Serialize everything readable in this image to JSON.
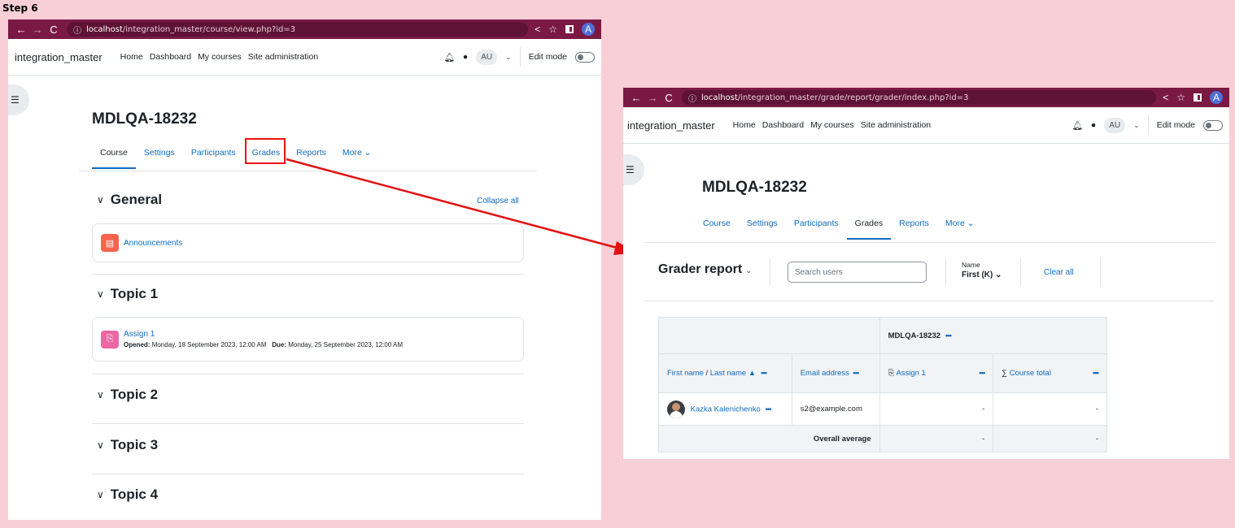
{
  "step_label": "Step 6",
  "left": {
    "url_host": "localhost",
    "url_path": "/integration_master/course/view.php?id=3",
    "brand": "integration_master",
    "nav": [
      "Home",
      "Dashboard",
      "My courses",
      "Site administration"
    ],
    "user_initials": "AU",
    "profile_letter": "A",
    "edit_mode": "Edit mode",
    "course_title": "MDLQA-18232",
    "tabs": [
      "Course",
      "Settings",
      "Participants",
      "Grades",
      "Reports",
      "More"
    ],
    "collapse_all": "Collapse all",
    "sections": {
      "general": "General",
      "topic1": "Topic 1",
      "topic2": "Topic 2",
      "topic3": "Topic 3",
      "topic4": "Topic 4"
    },
    "announcements": "Announcements",
    "assign": {
      "name": "Assign 1",
      "opened_label": "Opened:",
      "opened_value": "Monday, 18 September 2023, 12:00 AM",
      "due_label": "Due:",
      "due_value": "Monday, 25 September 2023, 12:00 AM"
    }
  },
  "right": {
    "url_host": "localhost",
    "url_path": "/integration_master/grade/report/grader/index.php?id=3",
    "brand": "integration_master",
    "nav": [
      "Home",
      "Dashboard",
      "My courses",
      "Site administration"
    ],
    "user_initials": "AU",
    "profile_letter": "A",
    "edit_mode": "Edit mode",
    "course_title": "MDLQA-18232",
    "tabs": [
      "Course",
      "Settings",
      "Participants",
      "Grades",
      "Reports",
      "More"
    ],
    "report_title": "Grader report",
    "search_placeholder": "Search users",
    "name_filter_label": "Name",
    "name_filter_value": "First (K)",
    "clear_all": "Clear all",
    "table": {
      "category": "MDLQA-18232",
      "col_first": "First name",
      "col_sep": " / ",
      "col_last": "Last name",
      "col_email": "Email address",
      "col_assign": "Assign 1",
      "col_total": "Course total",
      "student_name": "Kazka Kalenichenko",
      "student_email": "s2@example.com",
      "student_assign": "-",
      "student_total": "-",
      "overall_label": "Overall average",
      "overall_assign": "-",
      "overall_total": "-"
    }
  },
  "colors": {
    "chrome": "#7a1a44",
    "link": "#0f6cbf",
    "highlight": "#e11111"
  }
}
